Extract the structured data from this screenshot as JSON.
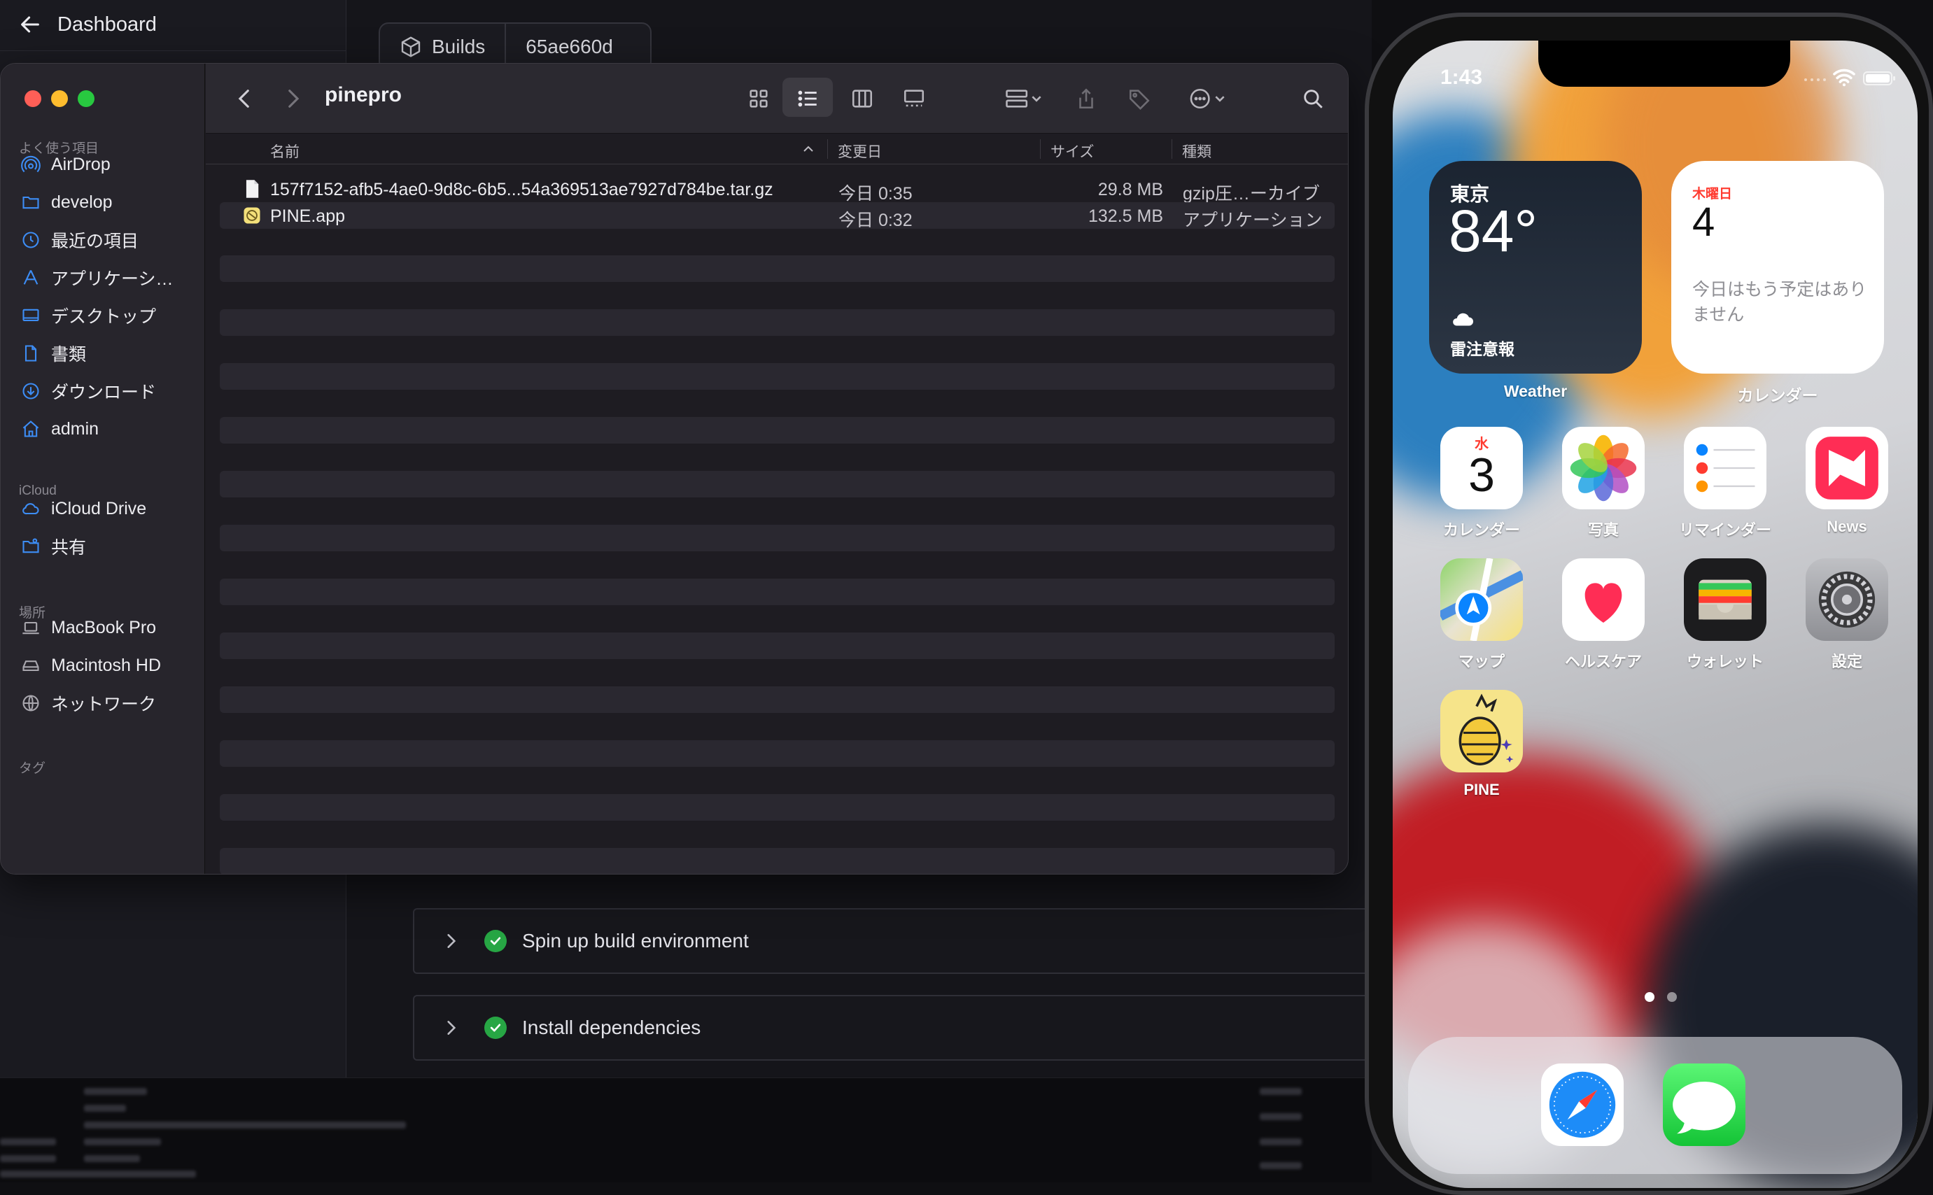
{
  "dashboard": {
    "back_label": "Dashboard",
    "breadcrumbs": [
      "Builds",
      "65ae660d"
    ],
    "steps": [
      {
        "label": "Spin up build environment",
        "status": "success"
      },
      {
        "label": "Install dependencies",
        "status": "success"
      }
    ]
  },
  "finder": {
    "title": "pinepro",
    "sidebar": {
      "favorites_title": "よく使う項目",
      "favorites": [
        {
          "label": "AirDrop",
          "icon": "airdrop-icon"
        },
        {
          "label": "develop",
          "icon": "folder-icon"
        },
        {
          "label": "最近の項目",
          "icon": "clock-icon"
        },
        {
          "label": "アプリケーシ…",
          "icon": "applications-icon"
        },
        {
          "label": "デスクトップ",
          "icon": "desktop-icon"
        },
        {
          "label": "書類",
          "icon": "document-icon"
        },
        {
          "label": "ダウンロード",
          "icon": "download-icon"
        },
        {
          "label": "admin",
          "icon": "home-icon"
        }
      ],
      "icloud_title": "iCloud",
      "icloud": [
        {
          "label": "iCloud Drive",
          "icon": "cloud-icon"
        },
        {
          "label": "共有",
          "icon": "shared-folder-icon"
        }
      ],
      "locations_title": "場所",
      "locations": [
        {
          "label": "MacBook Pro",
          "icon": "laptop-icon"
        },
        {
          "label": "Macintosh HD",
          "icon": "disk-icon"
        },
        {
          "label": "ネットワーク",
          "icon": "globe-icon"
        }
      ],
      "tags_title": "タグ"
    },
    "columns": {
      "name": "名前",
      "modified": "変更日",
      "size": "サイズ",
      "kind": "種類"
    },
    "files": [
      {
        "name": "157f7152-afb5-4ae0-9d8c-6b5...54a369513ae7927d784be.tar.gz",
        "modified": "今日 0:35",
        "size": "29.8 MB",
        "kind": "gzip圧…ーカイブ",
        "icon": "document-icon"
      },
      {
        "name": "PINE.app",
        "modified": "今日 0:32",
        "size": "132.5 MB",
        "kind": "アプリケーション",
        "icon": "app-icon"
      }
    ]
  },
  "phone": {
    "time": "1:43",
    "weather_widget": {
      "city": "東京",
      "temp": "84°",
      "condition": "雷注意報",
      "label": "Weather"
    },
    "calendar_widget": {
      "weekday": "木曜日",
      "day": "4",
      "message": "今日はもう予定はありません",
      "label": "カレンダー"
    },
    "calendar_app": {
      "weekday": "水",
      "day": "3"
    },
    "apps": [
      "カレンダー",
      "写真",
      "リマインダー",
      "News",
      "マップ",
      "ヘルスケア",
      "ウォレット",
      "設定",
      "PINE"
    ],
    "dock": [
      "safari-icon",
      "messages-icon"
    ]
  },
  "colors": {
    "accent_blue": "#3d8df5",
    "success_green": "#27a644",
    "calendar_red": "#ff3b30"
  }
}
